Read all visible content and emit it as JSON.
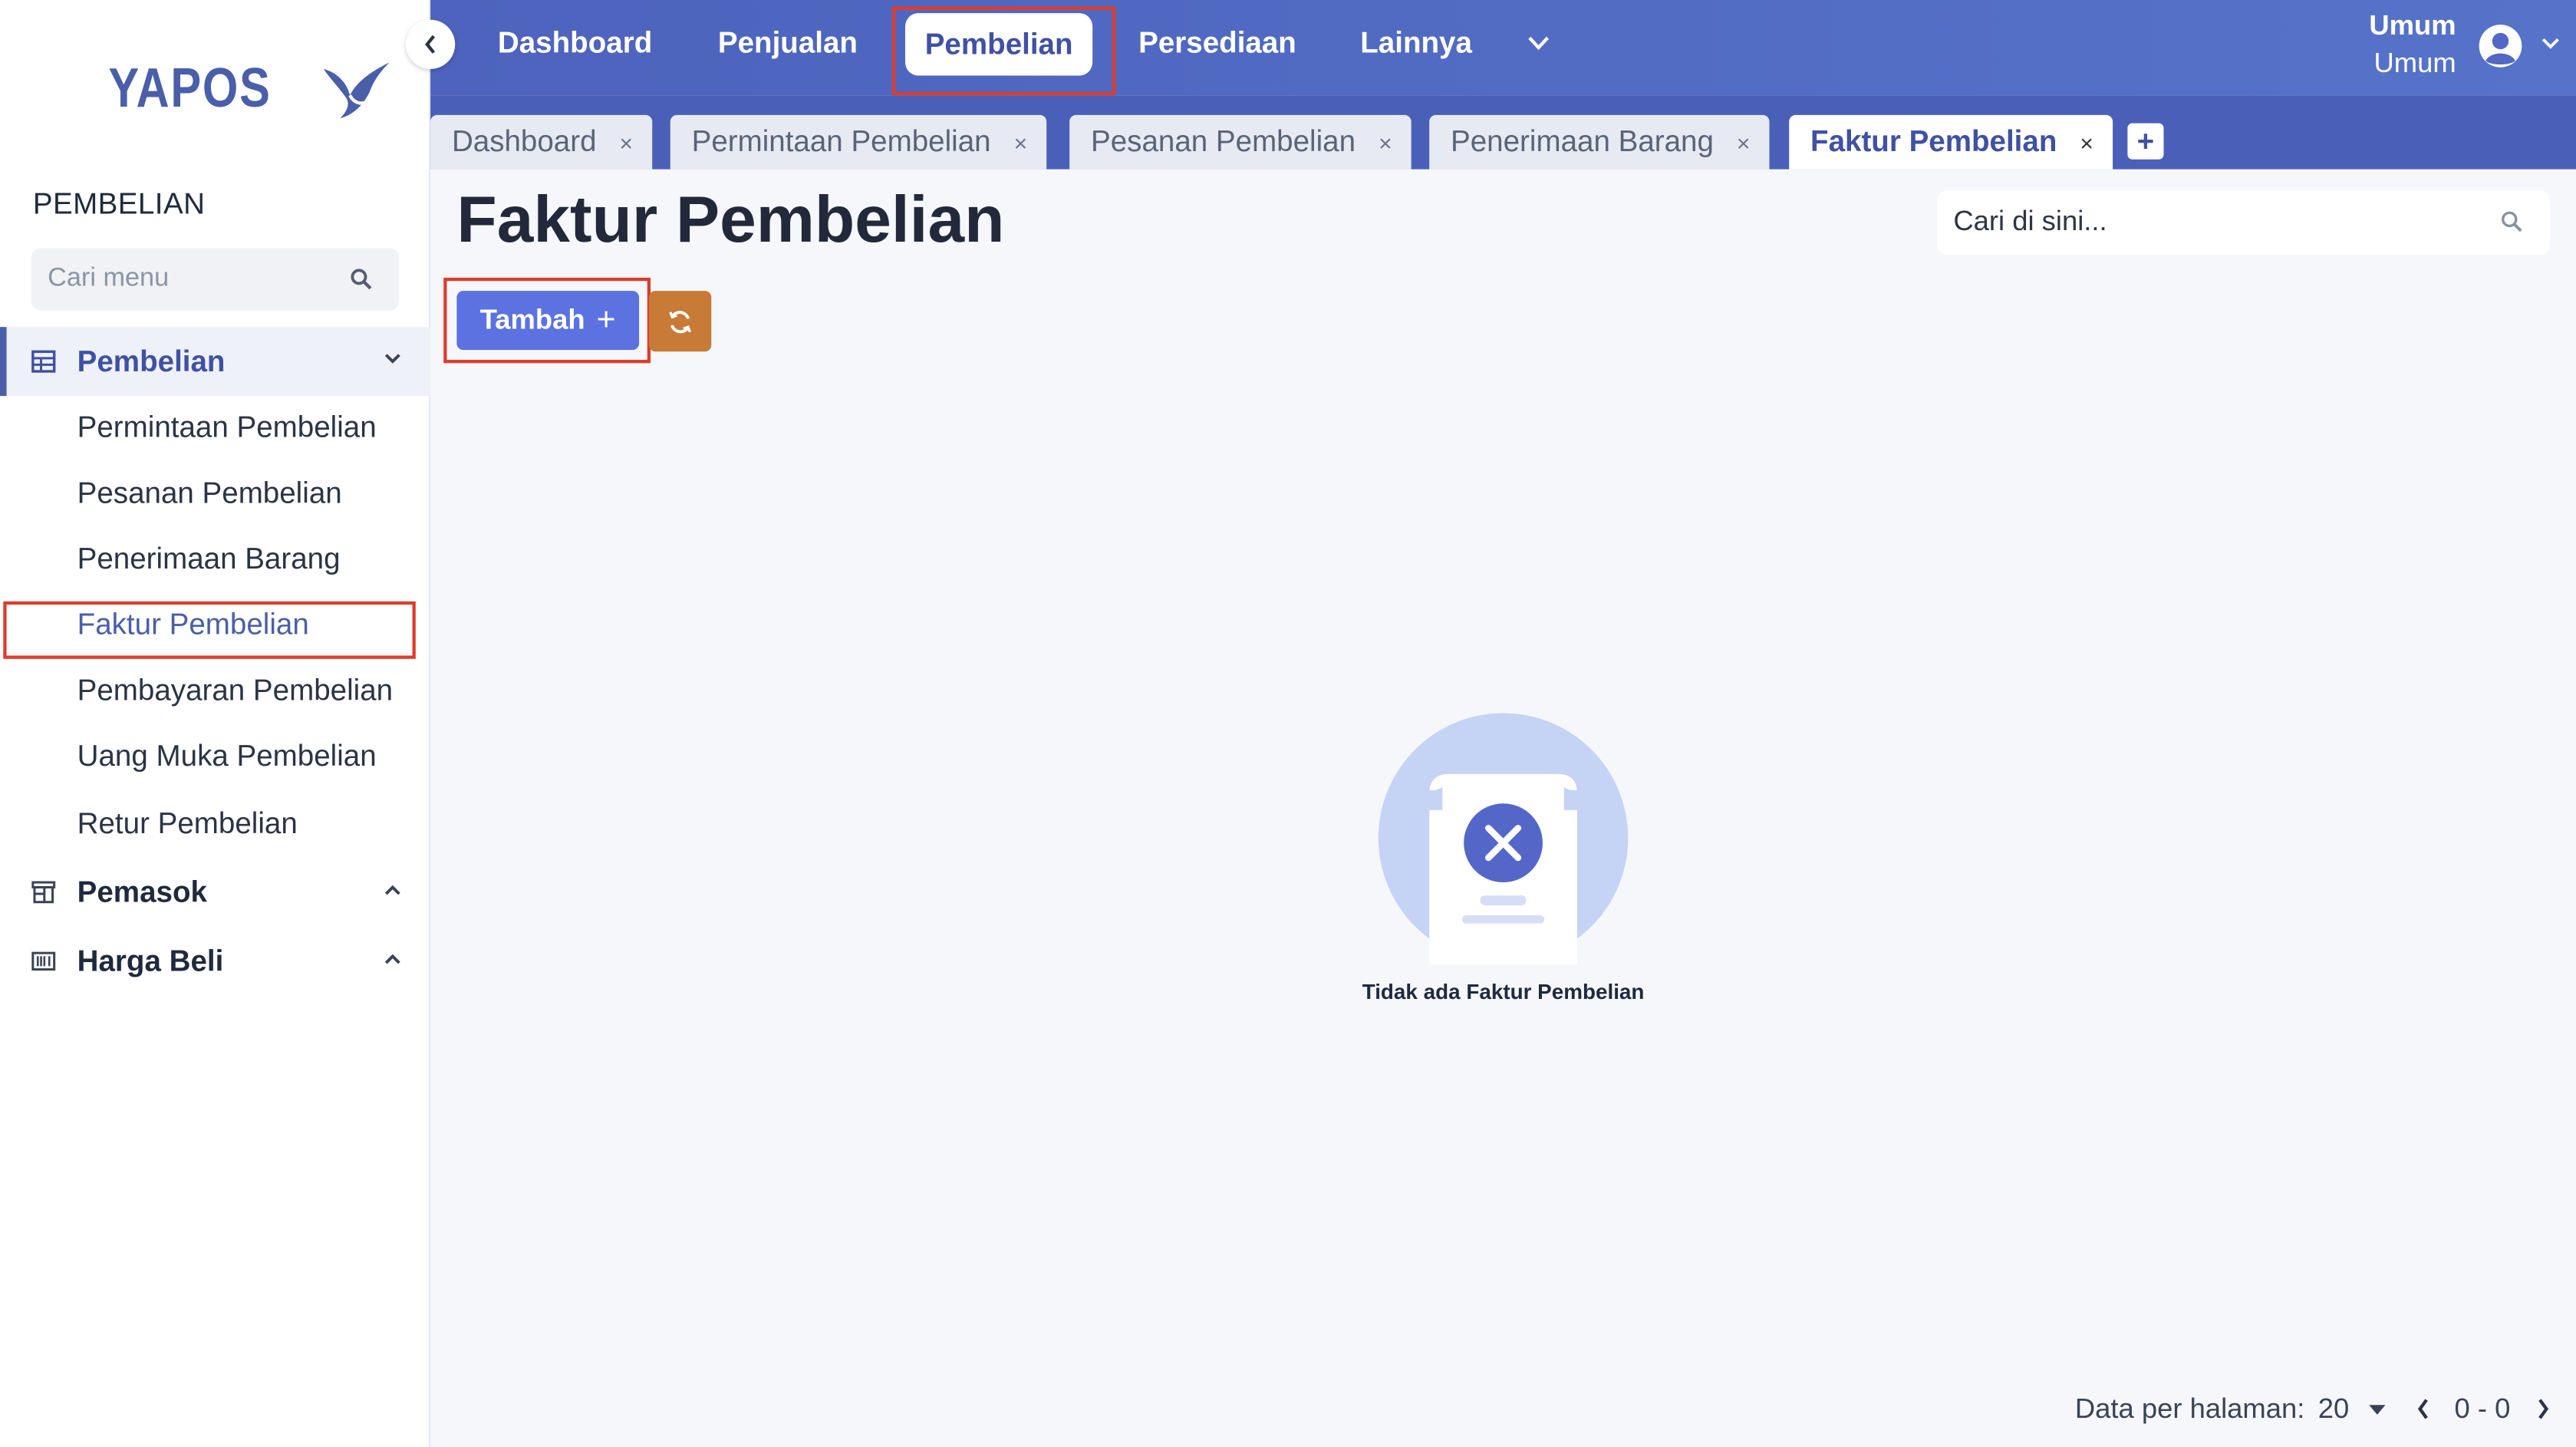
{
  "app": {
    "logo_text": "YAPOS",
    "brand_color": "#4a5fa8",
    "accent_color": "#5b72e0",
    "highlight_color": "#e03b2b"
  },
  "sidebar": {
    "section_title": "PEMBELIAN",
    "search_placeholder": "Cari menu",
    "groups": [
      {
        "label": "Pembelian",
        "icon": "table-icon",
        "expanded": true,
        "items": [
          {
            "label": "Permintaan Pembelian"
          },
          {
            "label": "Pesanan Pembelian"
          },
          {
            "label": "Penerimaan Barang"
          },
          {
            "label": "Faktur Pembelian",
            "selected": true
          },
          {
            "label": "Pembayaran Pembelian"
          },
          {
            "label": "Uang Muka Pembelian"
          },
          {
            "label": "Retur Pembelian"
          }
        ]
      },
      {
        "label": "Pemasok",
        "icon": "store-icon",
        "expanded": false
      },
      {
        "label": "Harga Beli",
        "icon": "barcode-icon",
        "expanded": false
      }
    ]
  },
  "topnav": {
    "items": [
      {
        "label": "Dashboard"
      },
      {
        "label": "Penjualan"
      },
      {
        "label": "Pembelian",
        "active": true
      },
      {
        "label": "Persediaan"
      },
      {
        "label": "Lainnya"
      }
    ]
  },
  "user": {
    "name": "Umum",
    "role": "Umum"
  },
  "tabs": [
    {
      "label": "Dashboard",
      "close": "×"
    },
    {
      "label": "Permintaan Pembelian",
      "close": "×"
    },
    {
      "label": "Pesanan Pembelian",
      "close": "×"
    },
    {
      "label": "Penerimaan Barang",
      "close": "×"
    },
    {
      "label": "Faktur Pembelian",
      "close": "×",
      "active": true
    }
  ],
  "tab_add_label": "+",
  "main": {
    "title": "Faktur Pembelian",
    "search_placeholder": "Cari di sini...",
    "add_button_label": "Tambah",
    "add_button_plus": "+",
    "empty_text": "Tidak ada Faktur Pembelian"
  },
  "pagination": {
    "per_page_label": "Data per halaman:",
    "per_page_value": "20",
    "range": "0 - 0"
  }
}
